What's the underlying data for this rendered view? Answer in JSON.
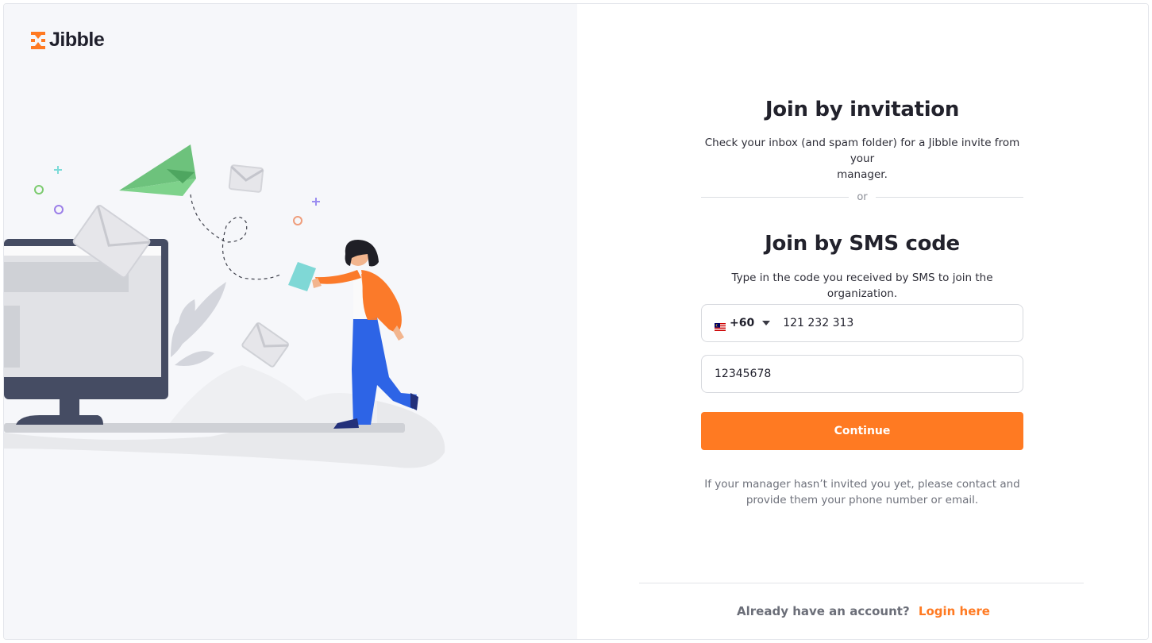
{
  "brand": {
    "name": "Jibble",
    "accent": "#ff7a22"
  },
  "invitation": {
    "title": "Join by invitation",
    "subtitle_line1": "Check your inbox (and spam folder) for a Jibble invite from your",
    "subtitle_line2": "manager."
  },
  "divider": {
    "label": "or"
  },
  "sms": {
    "title": "Join by SMS code",
    "subtitle": "Type in the code you received by SMS to join the organization.",
    "country_flag": "malaysia-flag-icon",
    "dial_code": "+60",
    "phone_value": "121 232 313",
    "code_value": "12345678",
    "continue_label": "Continue"
  },
  "note": {
    "line1": "If your manager hasn’t invited you yet, please contact and",
    "line2": "provide them your phone number or email."
  },
  "footer": {
    "question": "Already have an account?",
    "login_label": "Login here"
  }
}
